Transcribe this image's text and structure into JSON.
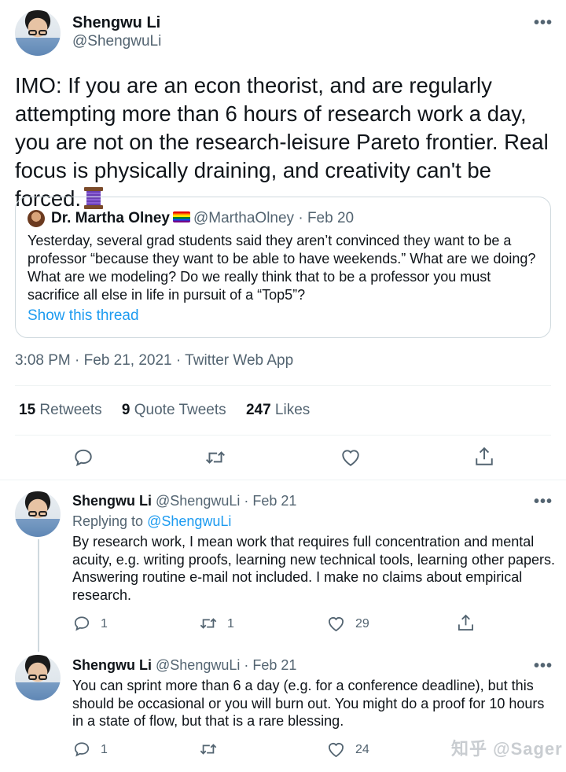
{
  "main_tweet": {
    "author_name": "Shengwu Li",
    "author_handle": "@ShengwuLi",
    "text": "IMO: If you are an econ theorist, and are regularly attempting more than 6 hours of research work a day, you are not on the research-leisure Pareto frontier. Real focus is physically draining, and creativity can't be forced.",
    "emoji": "thread-spool-icon",
    "more_label": "•••",
    "quote": {
      "author_name": "Dr. Martha Olney",
      "flag_icon": "rainbow-flag-icon",
      "handle_and_date": "@MarthaOlney · Feb 20",
      "text": "Yesterday, several grad students said they aren’t convinced they want to be a professor “because they want to be able to have weekends.” What are we doing? What are we modeling? Do we really think that to be a professor you must sacrifice all else in life in pursuit of a “Top5”?",
      "show_thread": "Show this thread"
    },
    "timestamp": "3:08 PM · Feb 21, 2021 · Twitter Web App",
    "stats": {
      "retweets_count": "15",
      "retweets_label": "Retweets",
      "quotes_count": "9",
      "quotes_label": "Quote Tweets",
      "likes_count": "247",
      "likes_label": "Likes"
    },
    "actions": [
      "reply-icon",
      "retweet-icon",
      "like-icon",
      "share-icon"
    ]
  },
  "replies": [
    {
      "author_name": "Shengwu Li",
      "handle_and_date": "@ShengwuLi · Feb 21",
      "replying_prefix": "Replying to",
      "replying_handle": "@ShengwuLi",
      "text": "By research work, I mean work that requires full concentration and mental acuity, e.g. writing proofs, learning new technical tools, learning other papers. Answering routine e-mail not included. I make no claims about empirical research.",
      "reply_count": "1",
      "retweet_count": "1",
      "like_count": "29"
    },
    {
      "author_name": "Shengwu Li",
      "handle_and_date": "@ShengwuLi · Feb 21",
      "text": "You can sprint more than 6 a day (e.g. for a conference deadline), but this should be occasional or you will burn out. You might do a proof for 10 hours in a state of flow, but that is a rare blessing.",
      "reply_count": "1",
      "like_count": "24"
    }
  ],
  "watermark": "知乎 @Sager",
  "colors": {
    "text": "#0f1419",
    "muted": "#536471",
    "link": "#1d9bf0",
    "border": "#cfd9de"
  }
}
